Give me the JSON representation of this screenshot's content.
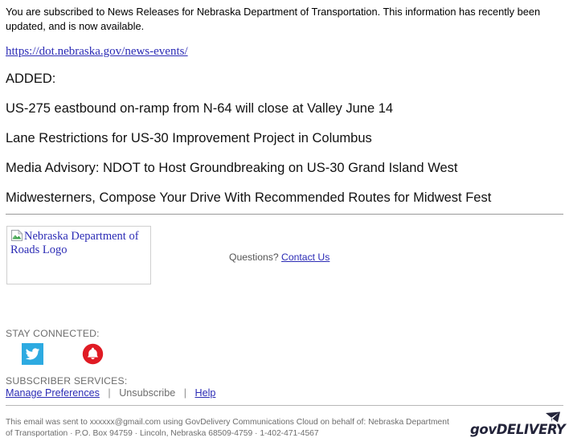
{
  "message": {
    "intro": "You are subscribed to News Releases for Nebraska Department of Transportation. This information has recently been updated, and is now available.",
    "url": "https://dot.nebraska.gov/news-events/",
    "section_label": "ADDED:",
    "headlines": [
      "US-275 eastbound on-ramp from N-64 will close at Valley June 14",
      "Lane Restrictions for US-30 Improvement Project in Columbus",
      "Media Advisory: NDOT to Host Groundbreaking on US-30 Grand Island West",
      "Midwesterners, Compose Your Drive With Recommended Routes for Midwest Fest"
    ]
  },
  "branding": {
    "logo_alt_text": "Nebraska Department of Roads Logo",
    "broken_image_icon": "broken-image-icon"
  },
  "questions": {
    "label": "Questions?",
    "link_label": "Contact Us"
  },
  "stay_connected": {
    "label": "STAY CONNECTED:",
    "icons": [
      {
        "name": "twitter-icon",
        "label": "Twitter",
        "color": "#2daae1"
      },
      {
        "name": "govdelivery-bell-icon",
        "label": "Email Updates",
        "color": "#e01b24"
      }
    ]
  },
  "subscriber_services": {
    "label": "SUBSCRIBER SERVICES:",
    "links": [
      {
        "label": "Manage Preferences",
        "style": "link"
      },
      {
        "label": "Unsubscribe",
        "style": "plain"
      },
      {
        "label": "Help",
        "style": "link"
      }
    ],
    "separator": "|"
  },
  "footer": {
    "text": "This email was sent to xxxxxx@gmail.com using GovDelivery Communications Cloud on behalf of: Nebraska Department of Transportation · P.O. Box 94759 · Lincoln, Nebraska 68509-4759 · 1-402-471-4567",
    "logo_text": "govDELIVERY"
  },
  "colors": {
    "link": "#2b2bb5",
    "muted_text": "#6d6d6d",
    "rule": "#9a9a9a",
    "twitter_blue": "#2daae1",
    "bell_red": "#e01b24",
    "logo_navy": "#23243a"
  }
}
